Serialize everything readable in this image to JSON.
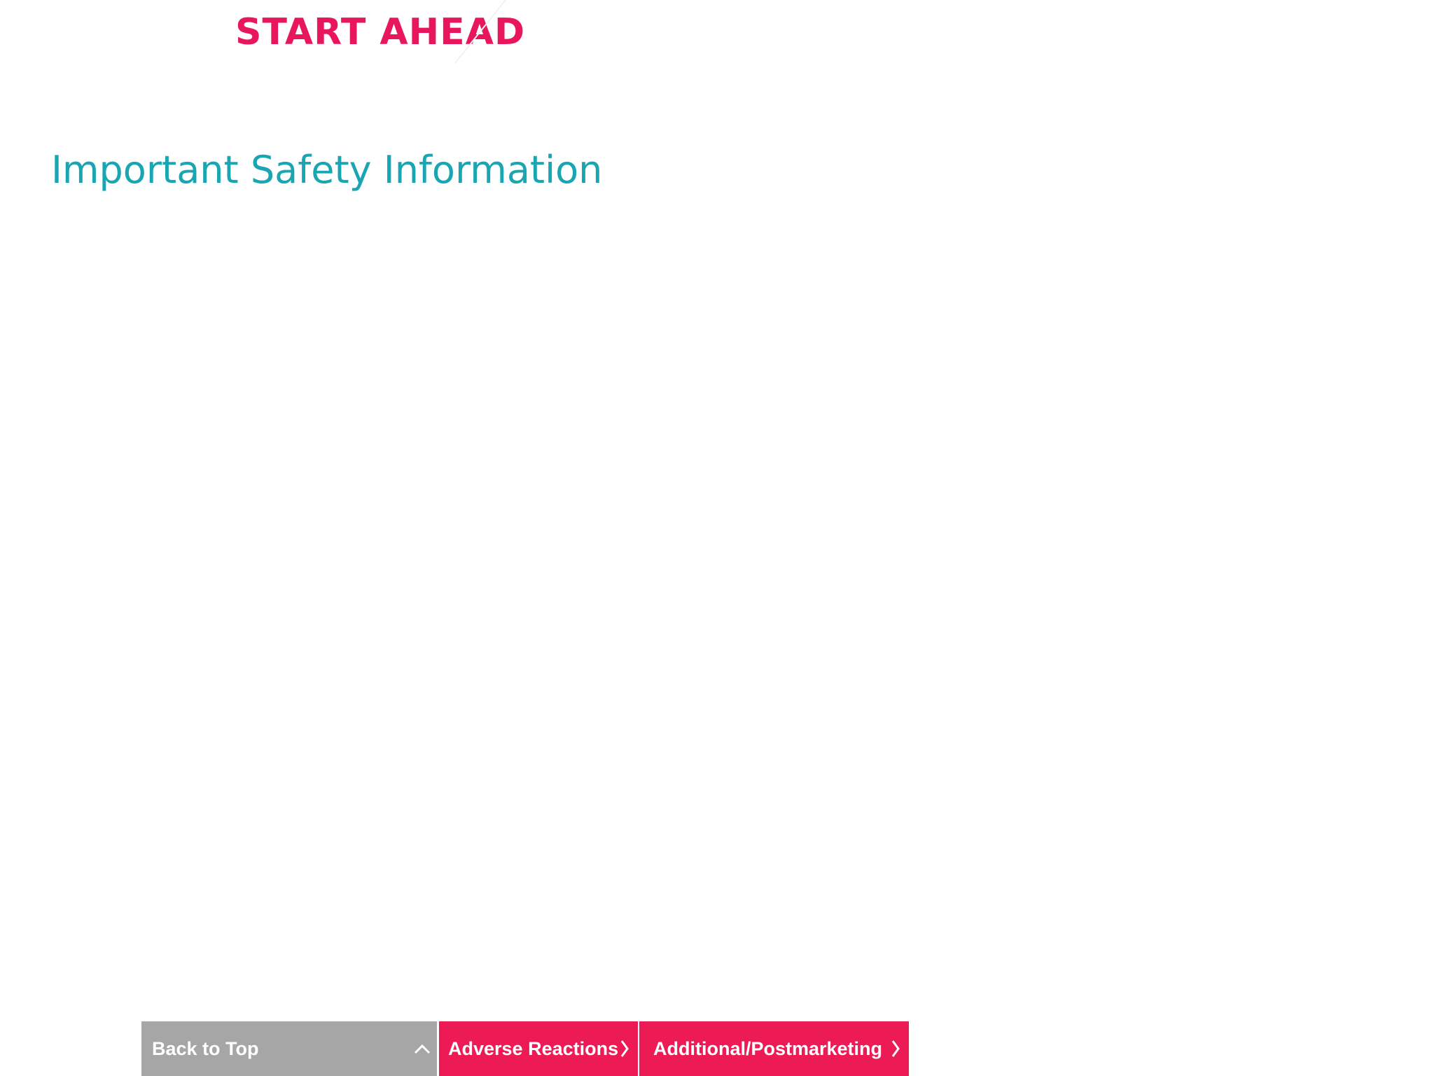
{
  "header": {
    "brand_text": "START AHEAD"
  },
  "main": {
    "title": "Important Safety Information"
  },
  "bottom_nav": {
    "buttons": [
      {
        "label": "Back to Top",
        "icon": "chevron-up-icon"
      },
      {
        "label": "Adverse Reactions",
        "icon": "chevron-right-icon"
      },
      {
        "label": "Additional/Postmarketing",
        "icon": "chevron-right-icon"
      }
    ]
  },
  "colors": {
    "brand": "#e8175d",
    "title": "#1aa5b3",
    "nav_gray": "#a6a6a6",
    "nav_pink": "#ed1b55",
    "background": "#ffffff"
  }
}
